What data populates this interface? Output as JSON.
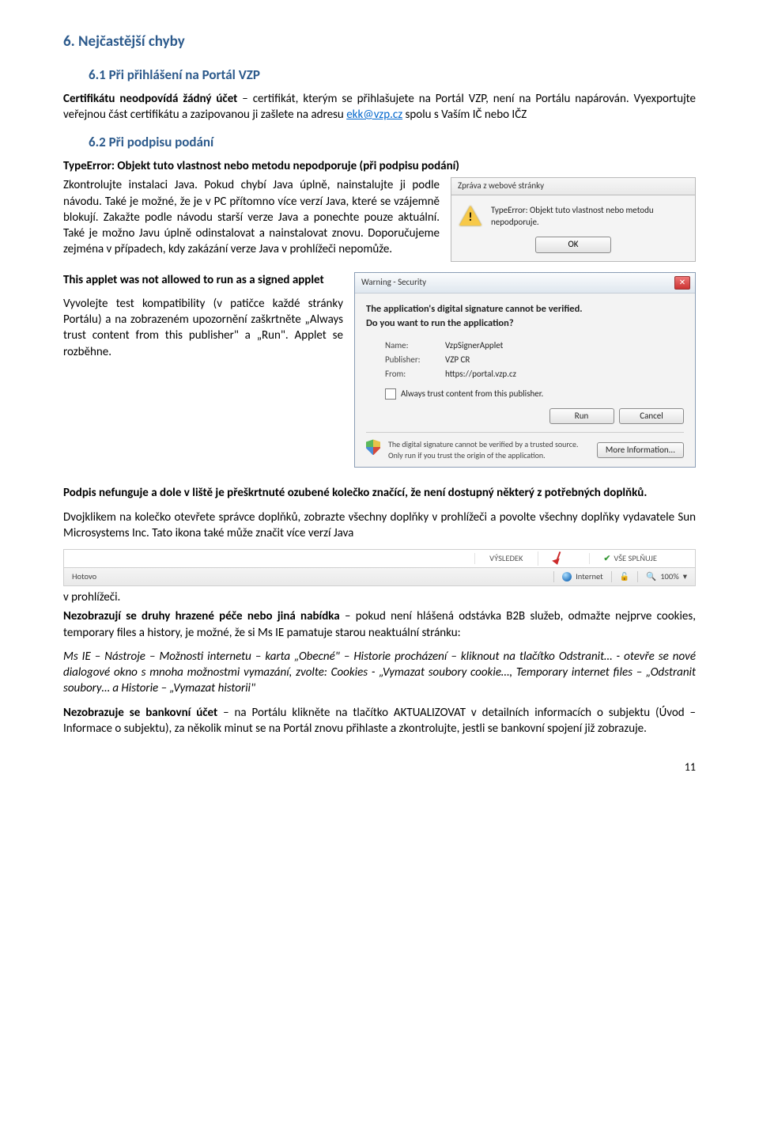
{
  "headings": {
    "h1": "6.  Nejčastější chyby",
    "h2a": "6.1 Při přihlášení na Portál VZP",
    "h2b": "6.2 Při podpisu podání"
  },
  "para": {
    "p1_lead": "Certifikátu neodpovídá žádný účet",
    "p1_rest": " – certifikát, kterým se přihlašujete na Portál VZP, není na Portálu napárován. Vyexportujte veřejnou část certifikátu a zazipovanou ji zašlete na adresu ",
    "p1_link": "ekk@vzp.cz",
    "p1_tail": " spolu s Vaším IČ nebo IČZ",
    "p2_lead": "TypeError: Objekt tuto vlastnost nebo metodu nepodporuje (při podpisu podání)",
    "p3": "Zkontrolujte instalaci Java. Pokud chybí Java úplně, nainstalujte ji podle návodu. Také je možné, že je v PC přítomno více verzí Java, které se vzájemně blokují. Zakažte podle návodu starší verze Java a ponechte pouze aktuální. Také je možno Javu úplně odinstalovat a nainstalovat znovu. Doporučujeme zejména v případech, kdy zakázání verze Java v prohlížeči nepomůže.",
    "p4_lead": "This applet was not allowed to run as a signed applet",
    "p5": "Vyvolejte test kompatibility (v patičce každé stránky Portálu) a na zobrazeném upozornění zaškrtněte „Always trust content from this publisher\" a „Run\". Applet se rozběhne.",
    "p6_lead": "Podpis nefunguje a dole v liště je přeškrtnuté ozubené kolečko značící, že není dostupný některý z potřebných doplňků.",
    "p7": "Dvojklikem na kolečko otevřete správce doplňků, zobrazte všechny doplňky v prohlížeči a povolte všechny doplňky vydavatele Sun Microsystems Inc. Tato ikona také může značit více verzí Java",
    "p7b": "v prohlížeči.",
    "p8_lead": "Nezobrazují se druhy hrazené péče nebo jiná nabídka",
    "p8_rest": " – pokud není hlášená odstávka B2B služeb, odmažte nejprve cookies, temporary files a history, je možné, že si Ms IE pamatuje starou neaktuální stránku:",
    "p9": "Ms IE – Nástroje – Možnosti internetu – karta „Obecné\" – Historie procházení – kliknout na tlačítko Odstranit… - otevře se nové dialogové okno s mnoha možnostmi vymazání, zvolte: Cookies - „Vymazat soubory cookie…, Temporary internet files – „Odstranit soubory… a Historie – „Vymazat historii\"",
    "p10_lead": "Nezobrazuje se bankovní účet",
    "p10_rest": " – na Portálu klikněte na tlačítko AKTUALIZOVAT v detailních informacích o subjektu (Úvod – Informace o subjektu), za několik minut se na Portál znovu přihlaste a zkontrolujte, jestli se bankovní spojení již zobrazuje."
  },
  "alert": {
    "title": "Zpráva z webové stránky",
    "msg": "TypeError: Objekt tuto vlastnost nebo metodu nepodporuje.",
    "ok": "OK"
  },
  "sec": {
    "title": "Warning - Security",
    "q1": "The application's digital signature cannot be verified.",
    "q2": "Do you want to run the application?",
    "name_k": "Name:",
    "name_v": "VzpSignerApplet",
    "pub_k": "Publisher:",
    "pub_v": "VZP CR",
    "from_k": "From:",
    "from_v": "https://portal.vzp.cz",
    "chk": "Always trust content from this publisher.",
    "run": "Run",
    "cancel": "Cancel",
    "note": "The digital signature cannot be verified by a trusted source. Only run if you trust the origin of the application.",
    "more": "More Information..."
  },
  "status": {
    "col1": "VÝSLEDEK",
    "col2": "VŠE SPLŇUJE",
    "done": "Hotovo",
    "zone": "Internet",
    "zoom": "100%"
  },
  "pagenum": "11"
}
